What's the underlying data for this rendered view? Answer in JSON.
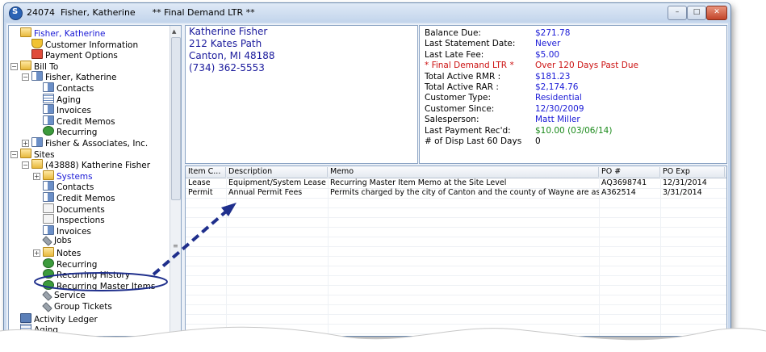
{
  "window": {
    "title": "24074  Fisher, Katherine      ** Final Demand LTR **",
    "controls": {
      "min": "–",
      "max": "□",
      "close": "✕"
    }
  },
  "tree": {
    "items": [
      {
        "label": "Fisher, Katherine",
        "icon": "folder-icon",
        "link": true
      },
      {
        "label": "Customer Information",
        "icon": "shield-icon"
      },
      {
        "label": "Payment Options",
        "icon": "payment-icon"
      },
      {
        "label": "Bill To",
        "icon": "folder-icon"
      },
      {
        "label": "Fisher, Katherine",
        "icon": "list-icon"
      },
      {
        "label": "Contacts",
        "icon": "contacts-icon"
      },
      {
        "label": "Aging",
        "icon": "grid-icon"
      },
      {
        "label": "Invoices",
        "icon": "list-icon"
      },
      {
        "label": "Credit Memos",
        "icon": "list-icon"
      },
      {
        "label": "Recurring",
        "icon": "recurring-icon"
      },
      {
        "label": "Fisher & Associates, Inc.",
        "icon": "list-icon"
      },
      {
        "label": "Sites",
        "icon": "folder-icon"
      },
      {
        "label": "(43888) Katherine Fisher",
        "icon": "folder-icon"
      },
      {
        "label": "Systems",
        "icon": "folder-icon",
        "link": true
      },
      {
        "label": "Contacts",
        "icon": "contacts-icon"
      },
      {
        "label": "Credit Memos",
        "icon": "list-icon"
      },
      {
        "label": "Documents",
        "icon": "document-icon"
      },
      {
        "label": "Inspections",
        "icon": "inspection-icon"
      },
      {
        "label": "Invoices",
        "icon": "list-icon"
      },
      {
        "label": "Jobs",
        "icon": "wrench-icon"
      },
      {
        "label": "Notes",
        "icon": "folder-icon"
      },
      {
        "label": "Recurring",
        "icon": "recurring-icon"
      },
      {
        "label": "Recurring History",
        "icon": "recurring-icon"
      },
      {
        "label": "Recurring Master Items",
        "icon": "recurring-icon",
        "highlighted": true
      },
      {
        "label": "Service",
        "icon": "wrench-icon"
      },
      {
        "label": "Group Tickets",
        "icon": "wrench-icon"
      },
      {
        "label": "Activity Ledger",
        "icon": "ledger-icon"
      },
      {
        "label": "Aging",
        "icon": "grid-icon"
      }
    ]
  },
  "address": {
    "name": "Katherine Fisher",
    "street": "212  Kates Path",
    "city": "Canton, MI 48188",
    "phone": "(734) 362-5553"
  },
  "info": {
    "rows": [
      {
        "label": "Balance Due:",
        "value": "$271.78"
      },
      {
        "label": "Last Statement Date:",
        "value": "Never"
      },
      {
        "label": "Last Late Fee:",
        "value": "$5.00"
      },
      {
        "label": " * Final Demand LTR *",
        "value": "Over 120 Days Past Due"
      },
      {
        "label": "Total Active RMR :",
        "value": "$181.23"
      },
      {
        "label": "Total Active RAR :",
        "value": "$2,174.76"
      },
      {
        "label": "Customer Type:",
        "value": "Residential"
      },
      {
        "label": "Customer Since:",
        "value": "12/30/2009"
      },
      {
        "label": "Salesperson:",
        "value": "Matt Miller"
      },
      {
        "label": "Last Payment Rec'd:",
        "value": "$10.00 (03/06/14)"
      },
      {
        "label": "# of Disp Last 60 Days",
        "value": "0"
      }
    ],
    "colors": {
      "value": "#1a1ad6",
      "alert": "#cc1111",
      "payment": "#1a8a1a",
      "label": "#000000"
    }
  },
  "grid": {
    "columns": [
      "Item C...",
      "Description",
      "Memo",
      "PO #",
      "PO Exp"
    ],
    "rows": [
      [
        "Lease",
        "Equipment/System Lease",
        "Recurring Master Item Memo at the Site Level",
        "AQ3698741",
        "12/31/2014"
      ],
      [
        "Permit",
        "Annual Permit Fees",
        "Permits charged by the city of Canton and the county of Wayne are assesse...",
        "A362514",
        "3/31/2014"
      ]
    ]
  }
}
